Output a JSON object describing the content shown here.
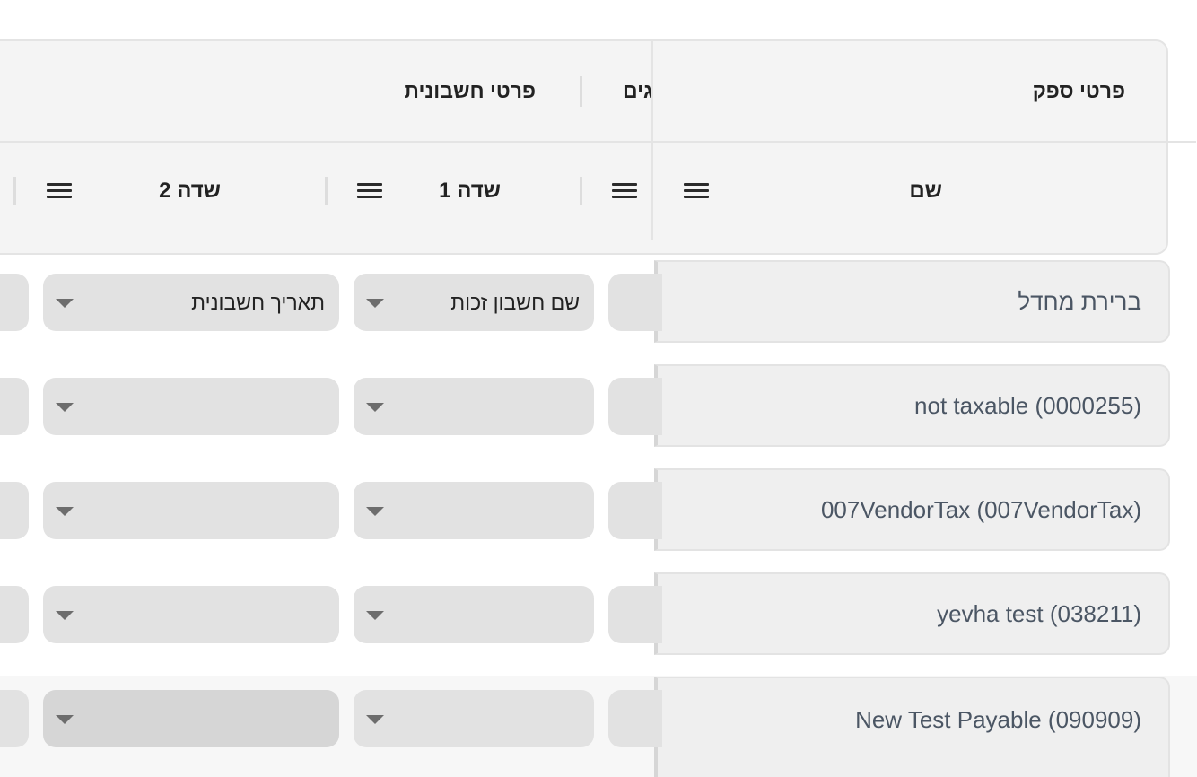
{
  "header": {
    "groups": {
      "supplier_details": "פרטי ספק",
      "invoice_details": "פרטי חשבונית",
      "partial_group": "גים"
    },
    "columns": {
      "name": "שם",
      "field1": "שדה 1",
      "field2": "שדה 2"
    }
  },
  "rows": [
    {
      "name": "ברירת מחדל",
      "field1": "שם חשבון זכות",
      "field2": "תאריך חשבונית"
    },
    {
      "name": "not taxable (0000255)",
      "field1": "",
      "field2": ""
    },
    {
      "name": "007VendorTax (007VendorTax)",
      "field1": "",
      "field2": ""
    },
    {
      "name": "yevha test (038211)",
      "field1": "",
      "field2": ""
    },
    {
      "name": "New Test Payable (090909)",
      "field1": "",
      "field2": ""
    }
  ],
  "icons": {
    "column_menu": "menu-icon",
    "dropdown": "chevron-down-icon"
  },
  "colors": {
    "header_bg": "#f4f4f4",
    "cell_bg": "#efefef",
    "select_bg": "#e2e2e2",
    "text": "#4b5664"
  }
}
